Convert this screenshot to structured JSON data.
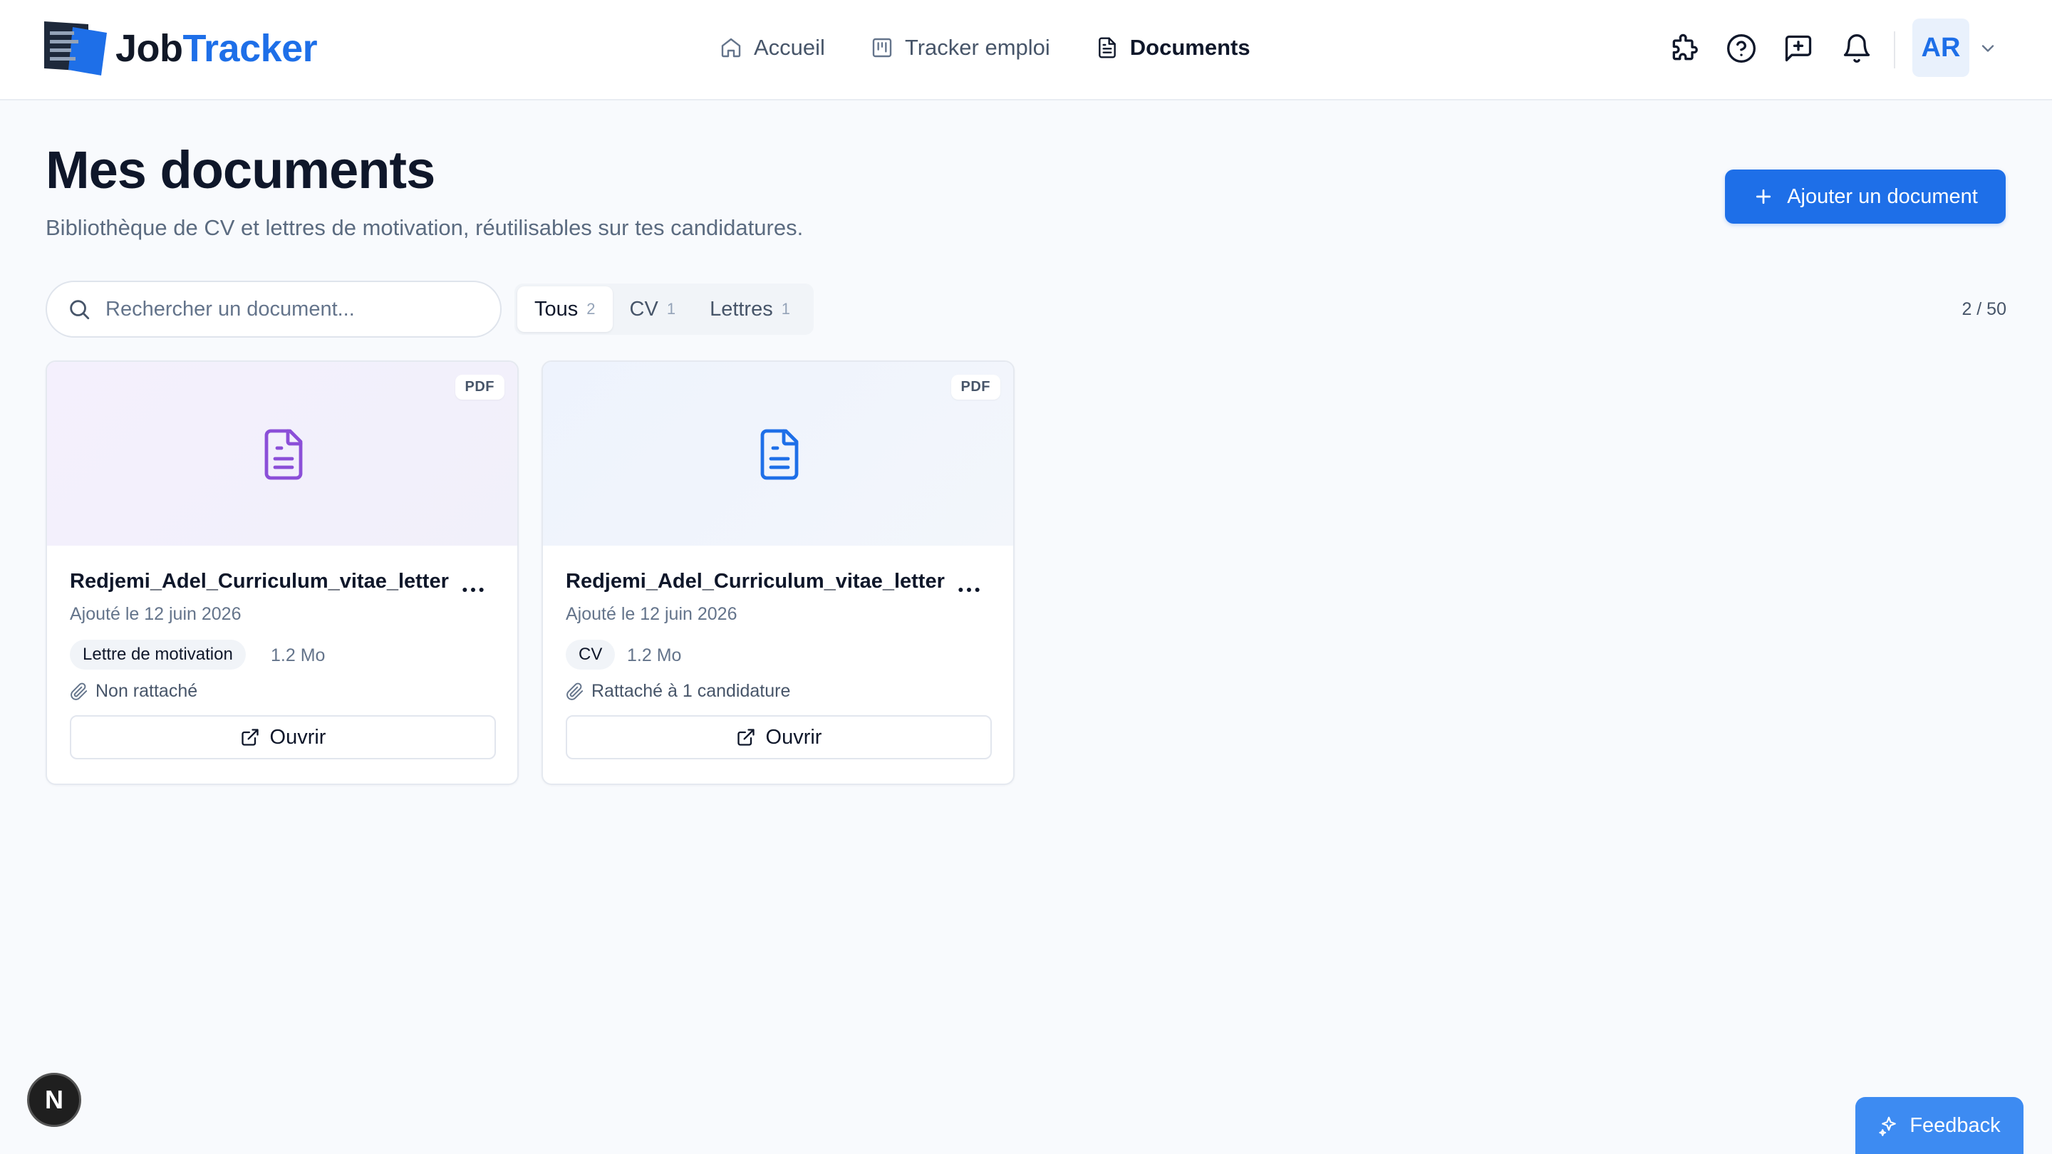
{
  "brand": {
    "part1": "Job",
    "part2": "Tracker",
    "accent": "#1e6fe8"
  },
  "nav": [
    {
      "label": "Accueil",
      "icon": "home-icon"
    },
    {
      "label": "Tracker emploi",
      "icon": "kanban-icon"
    },
    {
      "label": "Documents",
      "icon": "file-text-icon",
      "active": true
    }
  ],
  "header_icons": [
    "puzzle-icon",
    "help-circle-icon",
    "message-plus-icon",
    "bell-icon"
  ],
  "user": {
    "initials": "AR"
  },
  "page": {
    "title": "Mes documents",
    "subtitle": "Bibliothèque de CV et lettres de motivation, réutilisables sur tes candidatures.",
    "add_button": "Ajouter un document"
  },
  "search": {
    "placeholder": "Rechercher un document..."
  },
  "filters": [
    {
      "label": "Tous",
      "count": "2",
      "active": true
    },
    {
      "label": "CV",
      "count": "1"
    },
    {
      "label": "Lettres",
      "count": "1"
    }
  ],
  "counter": "2 / 50",
  "documents": [
    {
      "badge": "PDF",
      "title": "Redjemi_Adel_Curriculum_vitae_letter",
      "date": "Ajouté le 12 juin 2026",
      "tag": "Lettre de motivation",
      "size": "1.2 Mo",
      "attach": "Non rattaché",
      "open_label": "Ouvrir",
      "icon_color": "#8b4fd8"
    },
    {
      "badge": "PDF",
      "title": "Redjemi_Adel_Curriculum_vitae_letter",
      "date": "Ajouté le 12 juin 2026",
      "tag": "CV",
      "size": "1.2 Mo",
      "attach": "Rattaché à 1 candidature",
      "open_label": "Ouvrir",
      "icon_color": "#1e6fe8"
    }
  ],
  "dev_badge": "N",
  "feedback": "Feedback"
}
